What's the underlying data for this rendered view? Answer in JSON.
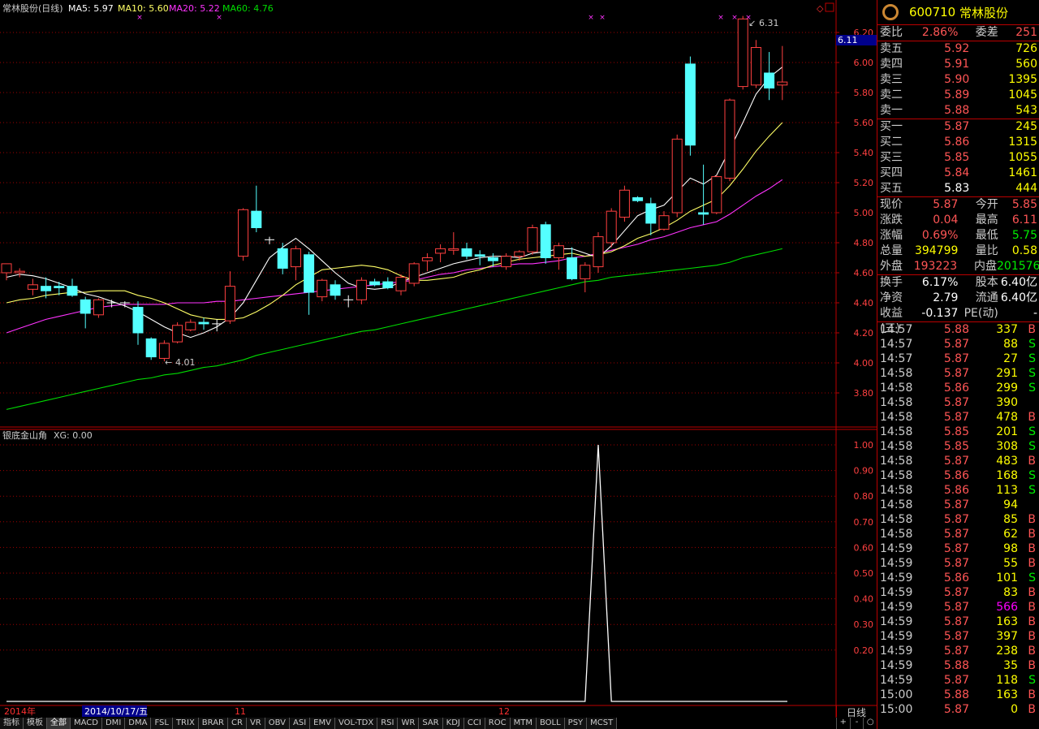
{
  "header": {
    "name": "常林股份(日线)",
    "ma5_label": "MA5: 5.97",
    "ma10_label": "MA10: 5.60",
    "ma20_label": "MA20: 5.22",
    "ma60_label": "MA60: 4.76",
    "indicator_name": "银底金山角",
    "indicator_value": "XG: 0.00"
  },
  "colors": {
    "up": "#ff4040",
    "down": "#54ffff",
    "ma5": "#ffffff",
    "ma10": "#ffff66",
    "ma20": "#ff33ff",
    "ma60": "#00dd00",
    "grid": "#a00000"
  },
  "axis": {
    "price_ticks": [
      "6.20",
      "6.00",
      "5.80",
      "5.60",
      "5.40",
      "5.20",
      "5.00",
      "4.80",
      "4.60",
      "4.40",
      "4.20",
      "4.00",
      "3.80"
    ],
    "indicator_ticks": [
      "1.00",
      "0.90",
      "0.80",
      "0.70",
      "0.60",
      "0.50",
      "0.40",
      "0.30",
      "0.20"
    ],
    "date_labels": [
      "2014年",
      "2014/10/17/五",
      "11",
      "12"
    ],
    "current_price_tag": "6.11",
    "period": "日线"
  },
  "annotations": {
    "high": "6.31",
    "low": "4.01"
  },
  "chart_data": [
    {
      "type": "candlestick",
      "title": "常林股份(日线)",
      "ylim": [
        3.6,
        6.27
      ],
      "candles": [
        {
          "o": 4.6,
          "c": 4.66,
          "h": 4.66,
          "l": 4.55
        },
        {
          "o": 4.6,
          "c": 4.61,
          "h": 4.63,
          "l": 4.57
        },
        {
          "o": 4.49,
          "c": 4.52,
          "h": 4.56,
          "l": 4.45
        },
        {
          "o": 4.51,
          "c": 4.48,
          "h": 4.57,
          "l": 4.43
        },
        {
          "o": 4.51,
          "c": 4.5,
          "h": 4.54,
          "l": 4.45
        },
        {
          "o": 4.51,
          "c": 4.45,
          "h": 4.56,
          "l": 4.44
        },
        {
          "o": 4.42,
          "c": 4.33,
          "h": 4.44,
          "l": 4.23
        },
        {
          "o": 4.32,
          "c": 4.42,
          "h": 4.43,
          "l": 4.3
        },
        {
          "o": 4.4,
          "c": 4.4,
          "h": 4.42,
          "l": 4.37
        },
        {
          "o": 4.4,
          "c": 4.4,
          "h": 4.41,
          "l": 4.37
        },
        {
          "o": 4.37,
          "c": 4.2,
          "h": 4.41,
          "l": 4.12
        },
        {
          "o": 4.16,
          "c": 4.04,
          "h": 4.17,
          "l": 4.02
        },
        {
          "o": 4.03,
          "c": 4.13,
          "h": 4.15,
          "l": 4.01
        },
        {
          "o": 4.14,
          "c": 4.25,
          "h": 4.27,
          "l": 4.13
        },
        {
          "o": 4.22,
          "c": 4.27,
          "h": 4.29,
          "l": 4.21
        },
        {
          "o": 4.27,
          "c": 4.26,
          "h": 4.3,
          "l": 4.22
        },
        {
          "o": 4.26,
          "c": 4.26,
          "h": 4.29,
          "l": 4.21
        },
        {
          "o": 4.28,
          "c": 4.51,
          "h": 4.61,
          "l": 4.26
        },
        {
          "o": 4.71,
          "c": 5.02,
          "h": 5.03,
          "l": 4.68
        },
        {
          "o": 5.01,
          "c": 4.9,
          "h": 5.18,
          "l": 4.87
        },
        {
          "o": 4.82,
          "c": 4.82,
          "h": 4.84,
          "l": 4.79
        },
        {
          "o": 4.76,
          "c": 4.63,
          "h": 4.8,
          "l": 4.59
        },
        {
          "o": 4.64,
          "c": 4.76,
          "h": 4.78,
          "l": 4.55
        },
        {
          "o": 4.72,
          "c": 4.47,
          "h": 4.74,
          "l": 4.32
        },
        {
          "o": 4.44,
          "c": 4.55,
          "h": 4.56,
          "l": 4.41
        },
        {
          "o": 4.52,
          "c": 4.45,
          "h": 4.55,
          "l": 4.42
        },
        {
          "o": 4.42,
          "c": 4.42,
          "h": 4.45,
          "l": 4.37
        },
        {
          "o": 4.42,
          "c": 4.55,
          "h": 4.57,
          "l": 4.39
        },
        {
          "o": 4.54,
          "c": 4.52,
          "h": 4.56,
          "l": 4.51
        },
        {
          "o": 4.54,
          "c": 4.5,
          "h": 4.57,
          "l": 4.49
        },
        {
          "o": 4.48,
          "c": 4.57,
          "h": 4.59,
          "l": 4.45
        },
        {
          "o": 4.53,
          "c": 4.66,
          "h": 4.67,
          "l": 4.51
        },
        {
          "o": 4.68,
          "c": 4.7,
          "h": 4.73,
          "l": 4.61
        },
        {
          "o": 4.73,
          "c": 4.76,
          "h": 4.79,
          "l": 4.67
        },
        {
          "o": 4.75,
          "c": 4.76,
          "h": 4.87,
          "l": 4.72
        },
        {
          "o": 4.76,
          "c": 4.71,
          "h": 4.8,
          "l": 4.69
        },
        {
          "o": 4.72,
          "c": 4.71,
          "h": 4.75,
          "l": 4.65
        },
        {
          "o": 4.7,
          "c": 4.68,
          "h": 4.73,
          "l": 4.64
        },
        {
          "o": 4.64,
          "c": 4.71,
          "h": 4.73,
          "l": 4.62
        },
        {
          "o": 4.71,
          "c": 4.74,
          "h": 4.75,
          "l": 4.68
        },
        {
          "o": 4.74,
          "c": 4.9,
          "h": 4.92,
          "l": 4.72
        },
        {
          "o": 4.92,
          "c": 4.7,
          "h": 4.94,
          "l": 4.66
        },
        {
          "o": 4.7,
          "c": 4.78,
          "h": 4.8,
          "l": 4.62
        },
        {
          "o": 4.7,
          "c": 4.56,
          "h": 4.77,
          "l": 4.55
        },
        {
          "o": 4.56,
          "c": 4.65,
          "h": 4.67,
          "l": 4.47
        },
        {
          "o": 4.64,
          "c": 4.84,
          "h": 4.87,
          "l": 4.6
        },
        {
          "o": 4.8,
          "c": 5.01,
          "h": 5.03,
          "l": 4.77
        },
        {
          "o": 4.97,
          "c": 5.15,
          "h": 5.18,
          "l": 4.94
        },
        {
          "o": 5.1,
          "c": 5.08,
          "h": 5.11,
          "l": 5.07
        },
        {
          "o": 5.06,
          "c": 4.93,
          "h": 5.1,
          "l": 4.85
        },
        {
          "o": 4.89,
          "c": 4.98,
          "h": 5.01,
          "l": 4.88
        },
        {
          "o": 5.0,
          "c": 5.49,
          "h": 5.52,
          "l": 4.97
        },
        {
          "o": 5.99,
          "c": 5.45,
          "h": 6.04,
          "l": 5.38
        },
        {
          "o": 5.0,
          "c": 4.99,
          "h": 5.32,
          "l": 4.92
        },
        {
          "o": 5.0,
          "c": 5.24,
          "h": 5.25,
          "l": 4.99
        },
        {
          "o": 5.23,
          "c": 5.75,
          "h": 5.76,
          "l": 5.21
        },
        {
          "o": 5.84,
          "c": 6.29,
          "h": 6.31,
          "l": 5.82
        },
        {
          "o": 5.85,
          "c": 6.1,
          "h": 6.15,
          "l": 5.83
        },
        {
          "o": 5.93,
          "c": 5.83,
          "h": 6.07,
          "l": 5.75
        },
        {
          "o": 5.85,
          "c": 5.87,
          "h": 6.11,
          "l": 5.75
        }
      ],
      "ma5": [
        4.57,
        4.59,
        4.58,
        4.56,
        4.53,
        4.5,
        4.46,
        4.44,
        4.41,
        4.38,
        4.34,
        4.29,
        4.24,
        4.2,
        4.17,
        4.2,
        4.24,
        4.3,
        4.4,
        4.55,
        4.7,
        4.77,
        4.83,
        4.76,
        4.68,
        4.6,
        4.53,
        4.5,
        4.49,
        4.5,
        4.54,
        4.57,
        4.6,
        4.63,
        4.66,
        4.68,
        4.7,
        4.71,
        4.71,
        4.7,
        4.73,
        4.74,
        4.76,
        4.76,
        4.73,
        4.7,
        4.78,
        4.88,
        4.98,
        5.02,
        5.05,
        5.14,
        5.23,
        5.19,
        5.25,
        5.42,
        5.6,
        5.79,
        5.9,
        5.97
      ],
      "ma10": [
        4.4,
        4.42,
        4.43,
        4.45,
        4.46,
        4.47,
        4.47,
        4.48,
        4.48,
        4.48,
        4.45,
        4.43,
        4.4,
        4.36,
        4.32,
        4.3,
        4.29,
        4.29,
        4.3,
        4.34,
        4.39,
        4.45,
        4.52,
        4.57,
        4.62,
        4.63,
        4.64,
        4.65,
        4.64,
        4.62,
        4.58,
        4.55,
        4.55,
        4.56,
        4.57,
        4.6,
        4.62,
        4.65,
        4.67,
        4.69,
        4.7,
        4.71,
        4.72,
        4.73,
        4.71,
        4.72,
        4.74,
        4.78,
        4.83,
        4.86,
        4.9,
        4.95,
        5.01,
        5.05,
        5.09,
        5.18,
        5.29,
        5.41,
        5.51,
        5.6
      ],
      "ma20": [
        4.2,
        4.23,
        4.26,
        4.29,
        4.31,
        4.33,
        4.35,
        4.37,
        4.38,
        4.39,
        4.39,
        4.39,
        4.39,
        4.4,
        4.4,
        4.4,
        4.41,
        4.41,
        4.42,
        4.43,
        4.44,
        4.45,
        4.46,
        4.47,
        4.48,
        4.49,
        4.5,
        4.51,
        4.52,
        4.53,
        4.54,
        4.55,
        4.57,
        4.59,
        4.6,
        4.62,
        4.63,
        4.64,
        4.65,
        4.66,
        4.66,
        4.67,
        4.68,
        4.7,
        4.71,
        4.73,
        4.75,
        4.77,
        4.79,
        4.82,
        4.84,
        4.87,
        4.9,
        4.92,
        4.94,
        4.99,
        5.05,
        5.11,
        5.16,
        5.22
      ],
      "ma60": [
        3.69,
        3.71,
        3.73,
        3.75,
        3.77,
        3.79,
        3.81,
        3.83,
        3.85,
        3.87,
        3.89,
        3.9,
        3.92,
        3.93,
        3.95,
        3.97,
        3.98,
        4.0,
        4.02,
        4.05,
        4.07,
        4.09,
        4.11,
        4.13,
        4.15,
        4.17,
        4.19,
        4.21,
        4.22,
        4.24,
        4.26,
        4.28,
        4.3,
        4.32,
        4.34,
        4.36,
        4.38,
        4.4,
        4.42,
        4.44,
        4.46,
        4.48,
        4.5,
        4.52,
        4.54,
        4.55,
        4.57,
        4.58,
        4.59,
        4.6,
        4.61,
        4.62,
        4.63,
        4.64,
        4.65,
        4.67,
        4.7,
        4.72,
        4.74,
        4.76
      ]
    },
    {
      "type": "line",
      "title": "银底金山角",
      "ylim": [
        0,
        1.0
      ],
      "x_range": [
        0,
        59
      ],
      "xg": [
        0,
        0,
        0,
        0,
        0,
        0,
        0,
        0,
        0,
        0,
        0,
        0,
        0,
        0,
        0,
        0,
        0,
        0,
        0,
        0,
        0,
        0,
        0,
        0,
        0,
        0,
        0,
        0,
        0,
        0,
        0,
        0,
        0,
        0,
        0,
        0,
        0,
        0,
        0,
        0,
        0,
        0,
        0,
        0,
        0,
        1,
        0,
        0,
        0,
        0,
        0,
        0,
        0,
        0,
        0,
        0,
        0,
        0,
        0,
        0
      ]
    }
  ],
  "quote": {
    "code": "600710",
    "name": "常林股份",
    "rows_top": [
      {
        "label": "委比",
        "val": "2.86%",
        "label2": "委差",
        "val2": "251"
      }
    ],
    "asks": [
      {
        "label": "卖五",
        "price": "5.92",
        "vol": "726"
      },
      {
        "label": "卖四",
        "price": "5.91",
        "vol": "560"
      },
      {
        "label": "卖三",
        "price": "5.90",
        "vol": "1395"
      },
      {
        "label": "卖二",
        "price": "5.89",
        "vol": "1045"
      },
      {
        "label": "卖一",
        "price": "5.88",
        "vol": "543"
      }
    ],
    "bids": [
      {
        "label": "买一",
        "price": "5.87",
        "vol": "245"
      },
      {
        "label": "买二",
        "price": "5.86",
        "vol": "1315"
      },
      {
        "label": "买三",
        "price": "5.85",
        "vol": "1055"
      },
      {
        "label": "买四",
        "price": "5.84",
        "vol": "1461"
      },
      {
        "label": "买五",
        "price": "5.83",
        "vol": "444"
      }
    ],
    "stats": [
      {
        "l1": "现价",
        "v1": "5.87",
        "l2": "今开",
        "v2": "5.85"
      },
      {
        "l1": "涨跌",
        "v1": "0.04",
        "l2": "最高",
        "v2": "6.11"
      },
      {
        "l1": "涨幅",
        "v1": "0.69%",
        "l2": "最低",
        "v2": "5.75"
      },
      {
        "l1": "总量",
        "v1": "394799",
        "l2": "量比",
        "v2": "0.58"
      },
      {
        "l1": "外盘",
        "v1": "193223",
        "l2": "内盘",
        "v2": "201576"
      }
    ],
    "stats2": [
      {
        "l1": "换手",
        "v1": "6.17%",
        "l2": "股本",
        "v2": "6.40亿"
      },
      {
        "l1": "净资",
        "v1": "2.79",
        "l2": "流通",
        "v2": "6.40亿"
      },
      {
        "l1": "收益(三)",
        "v1": "-0.137",
        "l2": "PE(动)",
        "v2": "-"
      }
    ],
    "ticks": [
      {
        "t": "14:57",
        "p": "5.88",
        "v": "337",
        "s": "B"
      },
      {
        "t": "14:57",
        "p": "5.87",
        "v": "88",
        "s": "S"
      },
      {
        "t": "14:57",
        "p": "5.87",
        "v": "27",
        "s": "S"
      },
      {
        "t": "14:58",
        "p": "5.87",
        "v": "291",
        "s": "S"
      },
      {
        "t": "14:58",
        "p": "5.86",
        "v": "299",
        "s": "S"
      },
      {
        "t": "14:58",
        "p": "5.87",
        "v": "390",
        "s": ""
      },
      {
        "t": "14:58",
        "p": "5.87",
        "v": "478",
        "s": "B"
      },
      {
        "t": "14:58",
        "p": "5.85",
        "v": "201",
        "s": "S"
      },
      {
        "t": "14:58",
        "p": "5.85",
        "v": "308",
        "s": "S"
      },
      {
        "t": "14:58",
        "p": "5.87",
        "v": "483",
        "s": "B"
      },
      {
        "t": "14:58",
        "p": "5.86",
        "v": "168",
        "s": "S"
      },
      {
        "t": "14:58",
        "p": "5.86",
        "v": "113",
        "s": "S"
      },
      {
        "t": "14:58",
        "p": "5.87",
        "v": "94",
        "s": ""
      },
      {
        "t": "14:58",
        "p": "5.87",
        "v": "85",
        "s": "B"
      },
      {
        "t": "14:58",
        "p": "5.87",
        "v": "62",
        "s": "B"
      },
      {
        "t": "14:59",
        "p": "5.87",
        "v": "98",
        "s": "B"
      },
      {
        "t": "14:59",
        "p": "5.87",
        "v": "55",
        "s": "B"
      },
      {
        "t": "14:59",
        "p": "5.86",
        "v": "101",
        "s": "S"
      },
      {
        "t": "14:59",
        "p": "5.87",
        "v": "83",
        "s": "B"
      },
      {
        "t": "14:59",
        "p": "5.87",
        "v": "566",
        "s": "B"
      },
      {
        "t": "14:59",
        "p": "5.87",
        "v": "163",
        "s": "B"
      },
      {
        "t": "14:59",
        "p": "5.87",
        "v": "397",
        "s": "B"
      },
      {
        "t": "14:59",
        "p": "5.87",
        "v": "238",
        "s": "B"
      },
      {
        "t": "14:59",
        "p": "5.88",
        "v": "35",
        "s": "B"
      },
      {
        "t": "14:59",
        "p": "5.87",
        "v": "118",
        "s": "S"
      },
      {
        "t": "15:00",
        "p": "5.88",
        "v": "163",
        "s": "B"
      },
      {
        "t": "15:00",
        "p": "5.87",
        "v": "0",
        "s": "B"
      }
    ]
  },
  "tabs": [
    "指标",
    "模板",
    "全部",
    "MACD",
    "DMI",
    "DMA",
    "FSL",
    "TRIX",
    "BRAR",
    "CR",
    "VR",
    "OBV",
    "ASI",
    "EMV",
    "VOL-TDX",
    "RSI",
    "WR",
    "SAR",
    "KDJ",
    "CCI",
    "ROC",
    "MTM",
    "BOLL",
    "PSY",
    "MCST"
  ],
  "scroll_buttons": [
    "+",
    "-",
    "○"
  ]
}
